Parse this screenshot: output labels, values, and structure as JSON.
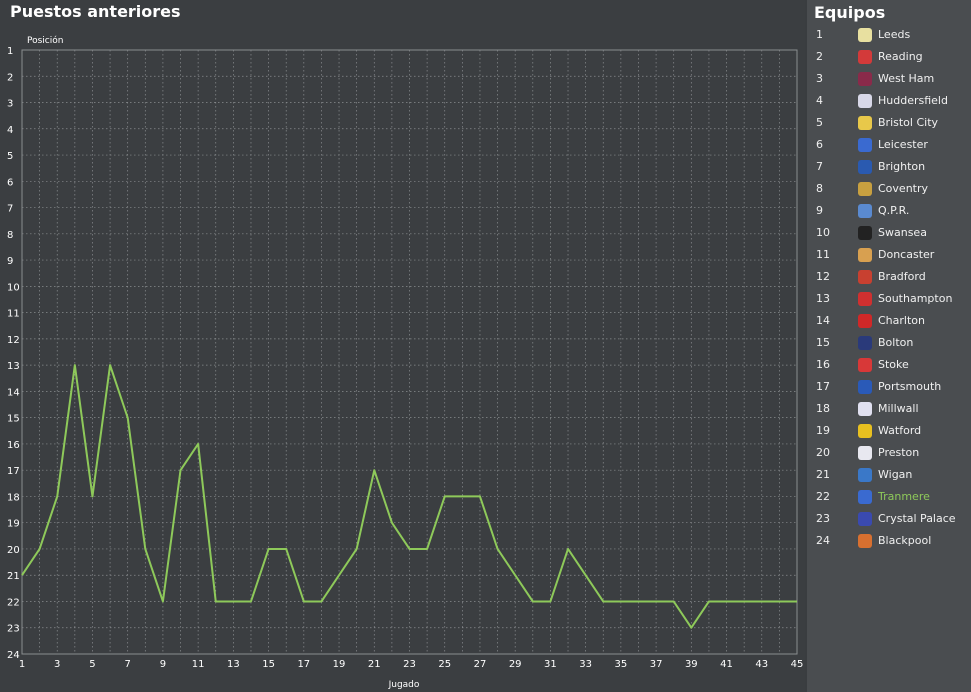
{
  "title": "Puestos anteriores",
  "sidebar": {
    "title": "Equipos",
    "teams": [
      {
        "pos": "1",
        "name": "Leeds",
        "badge_color": "#e8e0a0"
      },
      {
        "pos": "2",
        "name": "Reading",
        "badge_color": "#d33a3a"
      },
      {
        "pos": "3",
        "name": "West Ham",
        "badge_color": "#8a2a4a"
      },
      {
        "pos": "4",
        "name": "Huddersfield",
        "badge_color": "#d8d8e8"
      },
      {
        "pos": "5",
        "name": "Bristol City",
        "badge_color": "#e8c84a"
      },
      {
        "pos": "6",
        "name": "Leicester",
        "badge_color": "#3a6ad0"
      },
      {
        "pos": "7",
        "name": "Brighton",
        "badge_color": "#2a5ab0"
      },
      {
        "pos": "8",
        "name": "Coventry",
        "badge_color": "#c8a040"
      },
      {
        "pos": "9",
        "name": "Q.P.R.",
        "badge_color": "#5a8ad0"
      },
      {
        "pos": "10",
        "name": "Swansea",
        "badge_color": "#222222"
      },
      {
        "pos": "11",
        "name": "Doncaster",
        "badge_color": "#d8a050"
      },
      {
        "pos": "12",
        "name": "Bradford",
        "badge_color": "#c84030"
      },
      {
        "pos": "13",
        "name": "Southampton",
        "badge_color": "#d03030"
      },
      {
        "pos": "14",
        "name": "Charlton",
        "badge_color": "#d02828"
      },
      {
        "pos": "15",
        "name": "Bolton",
        "badge_color": "#2a3a7a"
      },
      {
        "pos": "16",
        "name": "Stoke",
        "badge_color": "#d83838"
      },
      {
        "pos": "17",
        "name": "Portsmouth",
        "badge_color": "#2a5ab8"
      },
      {
        "pos": "18",
        "name": "Millwall",
        "badge_color": "#e0e0f0"
      },
      {
        "pos": "19",
        "name": "Watford",
        "badge_color": "#e8c020"
      },
      {
        "pos": "20",
        "name": "Preston",
        "badge_color": "#e8e8f0"
      },
      {
        "pos": "21",
        "name": "Wigan",
        "badge_color": "#3a78c8"
      },
      {
        "pos": "22",
        "name": "Tranmere",
        "badge_color": "#3a6ad0",
        "highlight": true
      },
      {
        "pos": "23",
        "name": "Crystal Palace",
        "badge_color": "#3a4ab0"
      },
      {
        "pos": "24",
        "name": "Blackpool",
        "badge_color": "#d87030"
      }
    ]
  },
  "chart_data": {
    "type": "line",
    "title": "Puestos anteriores",
    "xlabel": "Jugado",
    "ylabel": "Posición",
    "xlim": [
      1,
      45
    ],
    "ylim": [
      1,
      24
    ],
    "y_inverted": true,
    "x_ticks": [
      1,
      3,
      5,
      7,
      9,
      11,
      13,
      15,
      17,
      19,
      21,
      23,
      25,
      27,
      29,
      31,
      33,
      35,
      37,
      39,
      41,
      43,
      45
    ],
    "y_ticks": [
      1,
      2,
      3,
      4,
      5,
      6,
      7,
      8,
      9,
      10,
      11,
      12,
      13,
      14,
      15,
      16,
      17,
      18,
      19,
      20,
      21,
      22,
      23,
      24
    ],
    "grid": true,
    "line_color": "#8ec95a",
    "series": [
      {
        "x": [
          1,
          2,
          3,
          4,
          5,
          6,
          7,
          8,
          9,
          10,
          11,
          12,
          13,
          14,
          15,
          16,
          17,
          18,
          19,
          20,
          21,
          22,
          23,
          24,
          25,
          26,
          27,
          28,
          29,
          30,
          31,
          32,
          33,
          34,
          35,
          36,
          37,
          38,
          39,
          40,
          41,
          42,
          43,
          44,
          45
        ],
        "y": [
          21,
          20,
          18,
          13,
          18,
          13,
          15,
          20,
          22,
          17,
          16,
          22,
          22,
          22,
          20,
          20,
          22,
          22,
          21,
          20,
          17,
          19,
          20,
          20,
          18,
          18,
          18,
          20,
          21,
          22,
          22,
          20,
          21,
          22,
          22,
          22,
          22,
          22,
          23,
          22,
          22,
          22,
          22,
          22,
          22
        ]
      }
    ]
  }
}
